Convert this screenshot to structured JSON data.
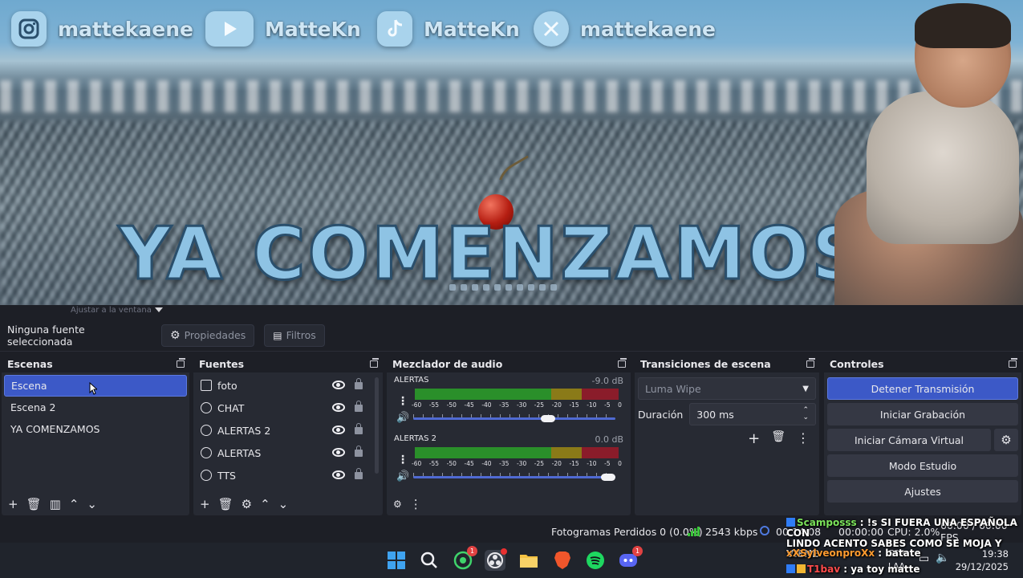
{
  "preview": {
    "socials": [
      {
        "icon": "instagram-icon",
        "name": "mattekaene"
      },
      {
        "icon": "youtube-icon",
        "name": "MatteKn"
      },
      {
        "icon": "tiktok-icon",
        "name": "MatteKn"
      },
      {
        "icon": "x-icon",
        "name": "mattekaene"
      }
    ],
    "headline": "YA COMENZAMOS"
  },
  "obs": {
    "top_strip_text": "Ajustar a la ventana",
    "source_bar": {
      "label": "Ninguna fuente seleccionada",
      "properties": "Propiedades",
      "filters": "Filtros"
    },
    "scenes": {
      "title": "Escenas",
      "items": [
        "Escena",
        "Escena 2",
        "YA COMENZAMOS"
      ],
      "selected": "Escena"
    },
    "sources": {
      "title": "Fuentes",
      "items": [
        {
          "name": "foto",
          "icon": "image-icon"
        },
        {
          "name": "CHAT",
          "icon": "globe-icon"
        },
        {
          "name": "ALERTAS 2",
          "icon": "globe-icon"
        },
        {
          "name": "ALERTAS",
          "icon": "globe-icon"
        },
        {
          "name": "TTS",
          "icon": "globe-icon"
        }
      ]
    },
    "mixer": {
      "title": "Mezclador de audio",
      "scale": [
        "-60",
        "-55",
        "-50",
        "-45",
        "-40",
        "-35",
        "-30",
        "-25",
        "-20",
        "-15",
        "-10",
        "-5",
        "0"
      ],
      "channels": [
        {
          "name": "ALERTAS",
          "db": "-9.0 dB",
          "volume": 0.68
        },
        {
          "name": "ALERTAS 2",
          "db": "0.0 dB",
          "volume": 1.0
        }
      ]
    },
    "transitions": {
      "title": "Transiciones de escena",
      "selected": "Luma Wipe",
      "duration_label": "Duración",
      "duration_value": "300 ms"
    },
    "controls": {
      "title": "Controles",
      "stop_stream": "Detener Transmisión",
      "start_recording": "Iniciar Grabación",
      "start_virtual_cam": "Iniciar Cámara Virtual",
      "studio_mode": "Modo Estudio",
      "settings": "Ajustes"
    },
    "status": {
      "dropped_frames": "Fotogramas Perdidos 0 (0.0%)",
      "bitrate": "2543 kbps",
      "stream_time": "00:14:08",
      "rec_time": "00:00:00",
      "cpu": "CPU: 2.0%",
      "fps": "60.00 / 60.00 FPS"
    }
  },
  "chat": [
    {
      "user": "Scamposss",
      "msg": "!s SI FUERA UNA ESPAÑOLA CON",
      "msg2": "LINDO ACENTO SABES COMO SE MOJA Y VIENE"
    },
    {
      "user": "xXSylveonproXx",
      "msg": "batate"
    },
    {
      "user": "T1bav",
      "msg": "ya toy matte"
    }
  ],
  "taskbar": {
    "badges": {
      "whatsapp": "1",
      "discord": "1"
    },
    "lang_top": "ESP",
    "lang_bottom": "LAA",
    "time": "19:38",
    "date": "29/12/2025"
  }
}
